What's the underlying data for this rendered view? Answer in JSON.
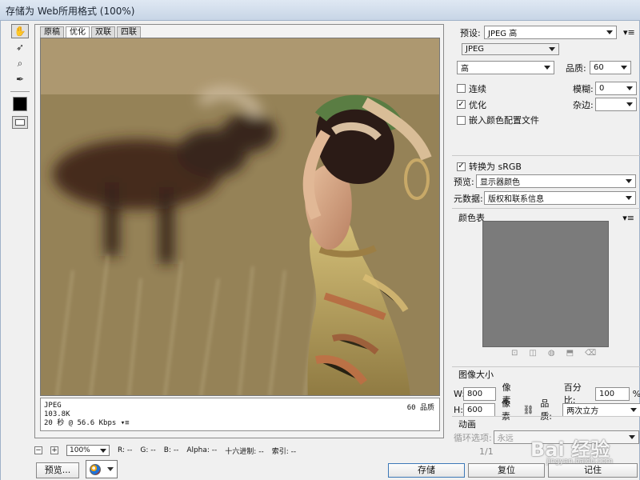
{
  "window": {
    "title": "存储为 Web所用格式 (100%)"
  },
  "tools": [
    {
      "name": "hand-tool",
      "icon": "hand-icon",
      "glyph": "✋",
      "active": true
    },
    {
      "name": "slice-select-tool",
      "icon": "slice-select-icon",
      "glyph": "➶",
      "active": false
    },
    {
      "name": "zoom-tool",
      "icon": "zoom-icon",
      "glyph": "⌕",
      "active": false
    },
    {
      "name": "eyedropper-tool",
      "icon": "eyedropper-icon",
      "glyph": "✒",
      "active": false
    }
  ],
  "tabs": [
    "原稿",
    "优化",
    "双联",
    "四联"
  ],
  "meta": {
    "format": "JPEG",
    "size": "103.8K",
    "time": "20 秒 @ 56.6 Kbps",
    "quality": "60 品质"
  },
  "bottom_info": {
    "zoom": "100%",
    "r": "R: --",
    "g": "G: --",
    "b": "B: --",
    "alpha": "Alpha: --",
    "hex": "十六进制: --",
    "index": "索引: --"
  },
  "buttons": {
    "preview": "预览...",
    "save": "存储",
    "reset": "复位",
    "remember": "记住"
  },
  "settings": {
    "preset_label": "预设:",
    "preset_value": "JPEG 高",
    "format_value": "JPEG",
    "compression_value": "高",
    "quality_label": "品质:",
    "quality_value": "60",
    "progressive": "连续",
    "blur_label": "模糊:",
    "blur_value": "0",
    "optimized": "优化",
    "matte_label": "杂边:",
    "matte_value": "",
    "embed_profile": "嵌入颜色配置文件",
    "convert_srgb": "转换为 sRGB",
    "preview_label": "预览:",
    "preview_value": "显示器颜色",
    "metadata_label": "元数据:",
    "metadata_value": "版权和联系信息",
    "color_table": "颜色表",
    "image_size": "图像大小",
    "width_label": "W:",
    "width_value": "800",
    "height_label": "H:",
    "height_value": "600",
    "pixel_unit": "像素",
    "percent_label": "百分比:",
    "percent_value": "100",
    "percent_symbol": "%",
    "quality_mode_label": "品质:",
    "quality_mode_value": "两次立方",
    "animation": "动画",
    "loop_label": "循环选项:",
    "loop_value": "永远",
    "frame_counter": "1/1"
  },
  "watermark": {
    "main": "Bai 经验",
    "sub": "jingyan.baidu.com"
  },
  "colors": {
    "title_bg": "#dfe8f3",
    "window_bg": "#f0f0f0",
    "accent": "#3c78b7"
  }
}
